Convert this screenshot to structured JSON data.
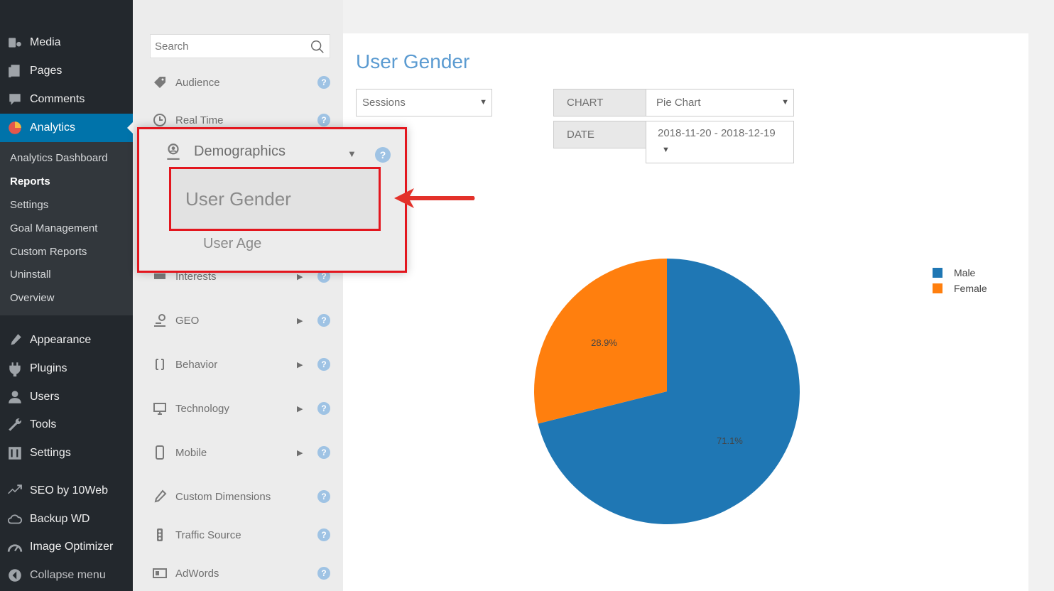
{
  "wp_menu": {
    "items_top": [
      {
        "label": "Media",
        "icon": "media-icon"
      },
      {
        "label": "Pages",
        "icon": "pages-icon"
      },
      {
        "label": "Comments",
        "icon": "comments-icon"
      },
      {
        "label": "Analytics",
        "icon": "analytics-icon"
      }
    ],
    "submenu": [
      "Analytics Dashboard",
      "Reports",
      "Settings",
      "Goal Management",
      "Custom Reports",
      "Uninstall",
      "Overview"
    ],
    "items_bottom": [
      {
        "label": "Appearance",
        "icon": "appearance-icon"
      },
      {
        "label": "Plugins",
        "icon": "plugins-icon"
      },
      {
        "label": "Users",
        "icon": "users-icon"
      },
      {
        "label": "Tools",
        "icon": "tools-icon"
      },
      {
        "label": "Settings",
        "icon": "settings-icon"
      },
      {
        "label": "SEO by 10Web",
        "icon": "seo-icon"
      },
      {
        "label": "Backup WD",
        "icon": "cloud-icon"
      },
      {
        "label": "Image Optimizer",
        "icon": "gauge-icon"
      },
      {
        "label": "Collapse menu",
        "icon": "collapse-icon"
      }
    ],
    "active": "Analytics",
    "current_sub": "Reports",
    "accent": "#0073aa"
  },
  "nav": {
    "search_placeholder": "Search",
    "items": [
      {
        "label": "Audience"
      },
      {
        "label": "Real Time"
      },
      {
        "label": "Interests"
      },
      {
        "label": "GEO"
      },
      {
        "label": "Behavior"
      },
      {
        "label": "Technology"
      },
      {
        "label": "Mobile"
      },
      {
        "label": "Custom Dimensions"
      },
      {
        "label": "Traffic Source"
      },
      {
        "label": "AdWords"
      }
    ],
    "help_glyph": "?",
    "expand_glyph": "▶"
  },
  "popup": {
    "group_label": "Demographics",
    "group_arrow": "▼",
    "selected_item": "User Gender",
    "other_item": "User Age",
    "highlight_color": "#e3161e"
  },
  "main": {
    "title": "User Gender",
    "metric_select": "Sessions",
    "chart_label": "CHART",
    "chart_select": "Pie Chart",
    "date_label": "DATE",
    "date_value": "2018-11-20 - 2018-12-19",
    "caret": "▼"
  },
  "chart_data": {
    "type": "pie",
    "categories": [
      "Male",
      "Female"
    ],
    "values": [
      71.1,
      28.9
    ],
    "data_labels": [
      "71.1%",
      "28.9%"
    ],
    "colors": [
      "#1f77b4",
      "#ff7f0e"
    ],
    "legend_position": "top-right"
  }
}
